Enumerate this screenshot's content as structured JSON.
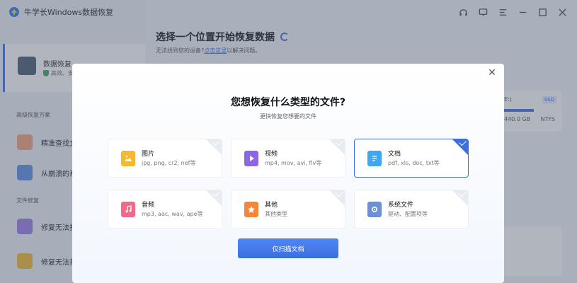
{
  "app": {
    "title": "牛学长Windows数据恢复",
    "colors": {
      "accent": "#3b6fe0",
      "sidebar": "#eef1f6"
    }
  },
  "window_controls": [
    "headset-icon",
    "feedback-icon",
    "menu-icon",
    "minimize-icon",
    "maximize-icon",
    "close-icon"
  ],
  "sidebar": {
    "active_item": {
      "title": "数据恢复",
      "subtitle": "高效、安"
    },
    "advanced_label": "高级恢复方案",
    "advanced_items": [
      {
        "label": "精准查找文"
      },
      {
        "label": "从崩溃的系"
      }
    ],
    "repair_label": "文件修复",
    "repair_items": [
      {
        "label": "修复无法打"
      },
      {
        "label": "修复无法打"
      }
    ]
  },
  "main": {
    "title": "选择一个位置开始恢复数据",
    "sub_prefix": "无法找到您的设备?",
    "sub_link": "点击这里",
    "sub_suffix": "以解决问题。",
    "disk": {
      "label": "E:)",
      "badge": "SSD",
      "size": "440.0 GB",
      "fs": "NTFS"
    }
  },
  "modal": {
    "title": "您想恢复什么类型的文件?",
    "subtitle": "更快恢复您想要的文件",
    "cards": [
      {
        "title": "图片",
        "desc": "jpg, png, cr2, nef等",
        "icon": "image-icon",
        "color": "#f5b82e",
        "selected": false
      },
      {
        "title": "视频",
        "desc": "mp4, mov, avi, flv等",
        "icon": "video-icon",
        "color": "#8b67e8",
        "selected": false
      },
      {
        "title": "文档",
        "desc": "pdf, xls, doc, txt等",
        "icon": "document-icon",
        "color": "#3fa6f0",
        "selected": true
      },
      {
        "title": "音频",
        "desc": "mp3, aac, wav, ape等",
        "icon": "audio-icon",
        "color": "#f06a8a",
        "selected": false
      },
      {
        "title": "其他",
        "desc": "其他类型",
        "icon": "star-icon",
        "color": "#f5863a",
        "selected": false
      },
      {
        "title": "系统文件",
        "desc": "驱动、配置项等",
        "icon": "system-icon",
        "color": "#6b8fd8",
        "selected": false
      }
    ],
    "scan_button": "仅扫描文档"
  }
}
